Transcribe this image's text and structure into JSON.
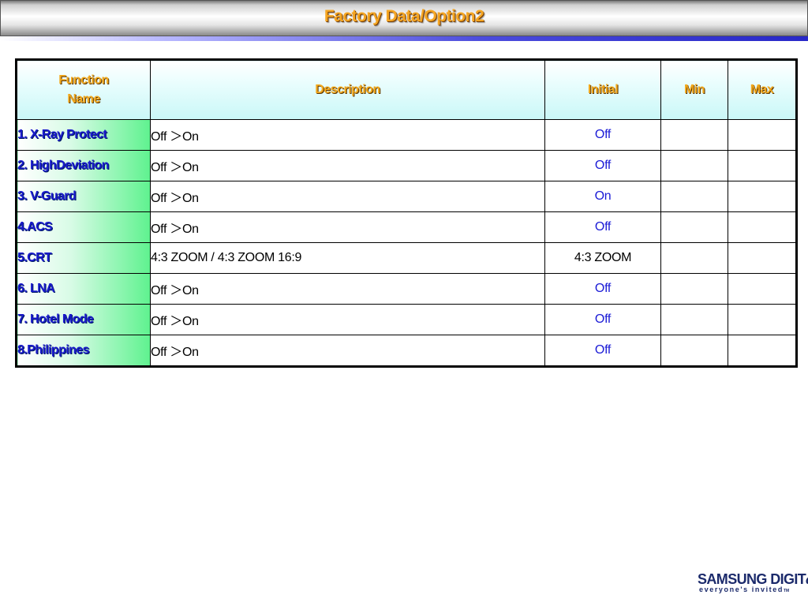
{
  "title": "Factory Data/Option2",
  "table": {
    "headers": {
      "function_line1": "Function",
      "function_line2": "Name",
      "description": "Description",
      "initial": "Initial",
      "min": "Min",
      "max": "Max"
    },
    "rows": [
      {
        "name": "1. X-Ray Protect",
        "description": "Off ＞On",
        "initial": "Off",
        "min": "",
        "max": ""
      },
      {
        "name": "2. HighDeviation",
        "description": "Off ＞On",
        "initial": "Off",
        "min": "",
        "max": ""
      },
      {
        "name": "3. V-Guard",
        "description": "Off ＞On",
        "initial": "On",
        "min": "",
        "max": ""
      },
      {
        "name": "4.ACS",
        "description": "Off ＞On",
        "initial": "Off",
        "min": "",
        "max": ""
      },
      {
        "name": "5.CRT",
        "description": "4:3 ZOOM / 4:3 ZOOM 16:9",
        "initial": "4:3 ZOOM",
        "min": "",
        "max": ""
      },
      {
        "name": "6. LNA",
        "description": "Off ＞On",
        "initial": "Off",
        "min": "",
        "max": ""
      },
      {
        "name": "7. Hotel Mode",
        "description": "Off ＞On",
        "initial": "Off",
        "min": "",
        "max": ""
      },
      {
        "name": "8.Philippines",
        "description": "Off ＞On",
        "initial": "Off",
        "min": "",
        "max": ""
      }
    ]
  },
  "logo": {
    "main": "SAMSUNG DIGIT",
    "main_suffix": "all",
    "tagline": "everyone's invited",
    "tm": "TM"
  },
  "colors": {
    "title": "#f5a623",
    "header_text": "#f2a81d",
    "function_name_text": "#1a1acc",
    "initial_value_text": "#1a1ad6",
    "brand": "#1b2a6b"
  }
}
